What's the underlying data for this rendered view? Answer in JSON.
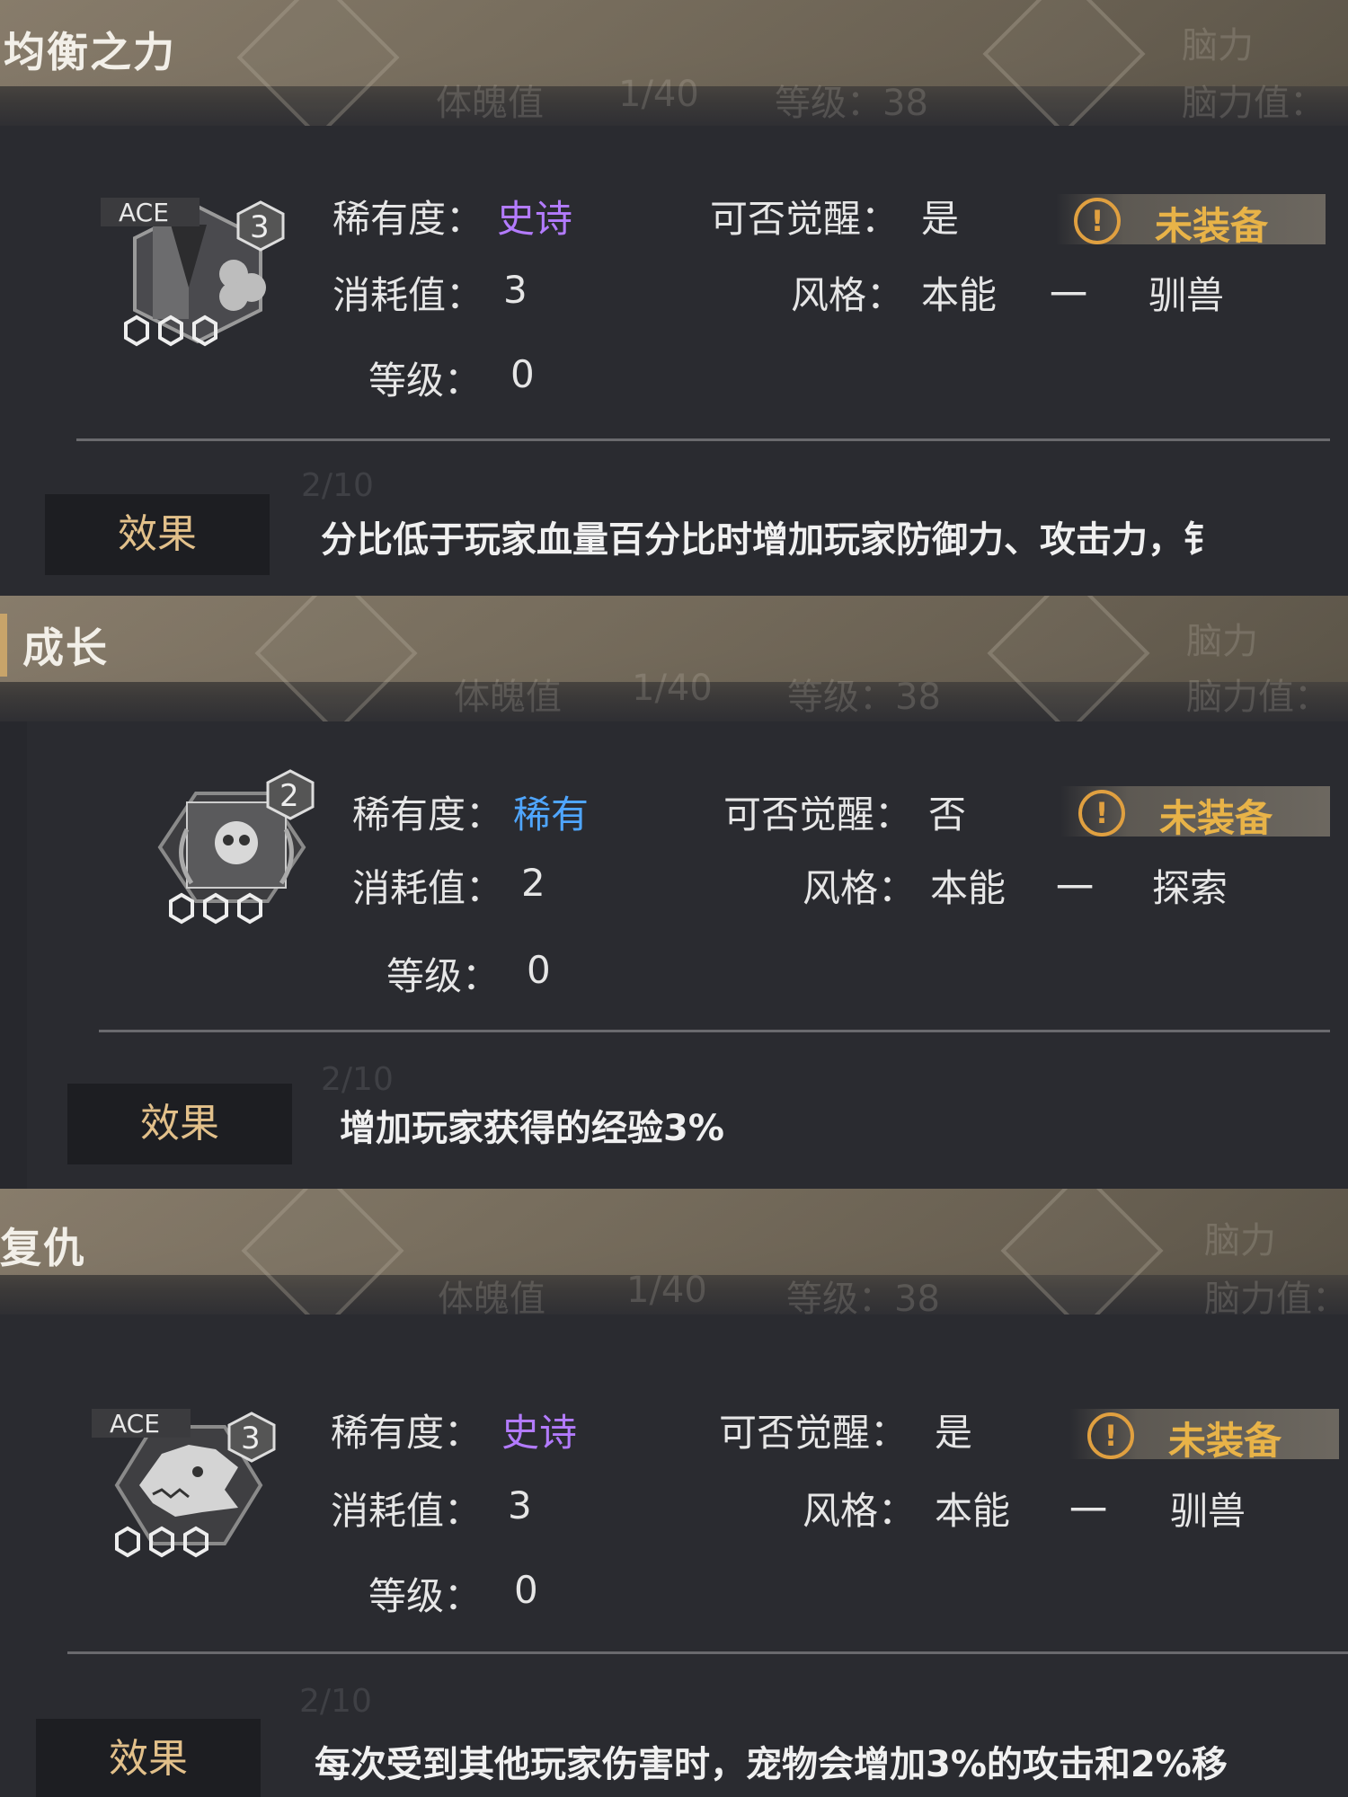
{
  "cards": [
    {
      "title": "均衡之力",
      "ghost": {
        "a": "体魄值",
        "b": "1/40",
        "c": "等级：38",
        "d": "脑力",
        "e": "脑力值："
      },
      "rarity_label": "稀有度：",
      "rarity_value": "史诗",
      "rarity_color": "#b37bff",
      "cost_label": "消耗值：",
      "cost_value": "3",
      "level_label": "等级：",
      "level_value": "0",
      "awaken_label": "可否觉醒：",
      "awaken_value": "是",
      "style_label": "风格：",
      "style_primary": "本能",
      "style_dash": "一",
      "style_secondary": "驯兽",
      "status_text": "未装备",
      "status_icon": "!",
      "badge_level": "3",
      "ace_tag": "ACE",
      "effect_tab": "效果",
      "effect_text": "分比低于玩家血量百分比时增加玩家防御力、攻击力，钅",
      "ghost_progress": "2/10"
    },
    {
      "title": "成长",
      "ghost": {
        "a": "体魄值",
        "b": "1/40",
        "c": "等级：38",
        "d": "脑力",
        "e": "脑力值："
      },
      "rarity_label": "稀有度：",
      "rarity_value": "稀有",
      "rarity_color": "#4fa6ff",
      "cost_label": "消耗值：",
      "cost_value": "2",
      "level_label": "等级：",
      "level_value": "0",
      "awaken_label": "可否觉醒：",
      "awaken_value": "否",
      "style_label": "风格：",
      "style_primary": "本能",
      "style_dash": "一",
      "style_secondary": "探索",
      "status_text": "未装备",
      "status_icon": "!",
      "badge_level": "2",
      "ace_tag": "",
      "effect_tab": "效果",
      "effect_text": "增加玩家获得的经验3%",
      "ghost_progress": "2/10"
    },
    {
      "title": "复仇",
      "ghost": {
        "a": "体魄值",
        "b": "1/40",
        "c": "等级：38",
        "d": "脑力",
        "e": "脑力值："
      },
      "rarity_label": "稀有度：",
      "rarity_value": "史诗",
      "rarity_color": "#b37bff",
      "cost_label": "消耗值：",
      "cost_value": "3",
      "level_label": "等级：",
      "level_value": "0",
      "awaken_label": "可否觉醒：",
      "awaken_value": "是",
      "style_label": "风格：",
      "style_primary": "本能",
      "style_dash": "一",
      "style_secondary": "驯兽",
      "status_text": "未装备",
      "status_icon": "!",
      "badge_level": "3",
      "ace_tag": "ACE",
      "effect_tab": "效果",
      "effect_text": "每次受到其他玩家伤害时，宠物会增加3%的攻击和2%移",
      "ghost_progress": "2/10"
    }
  ]
}
